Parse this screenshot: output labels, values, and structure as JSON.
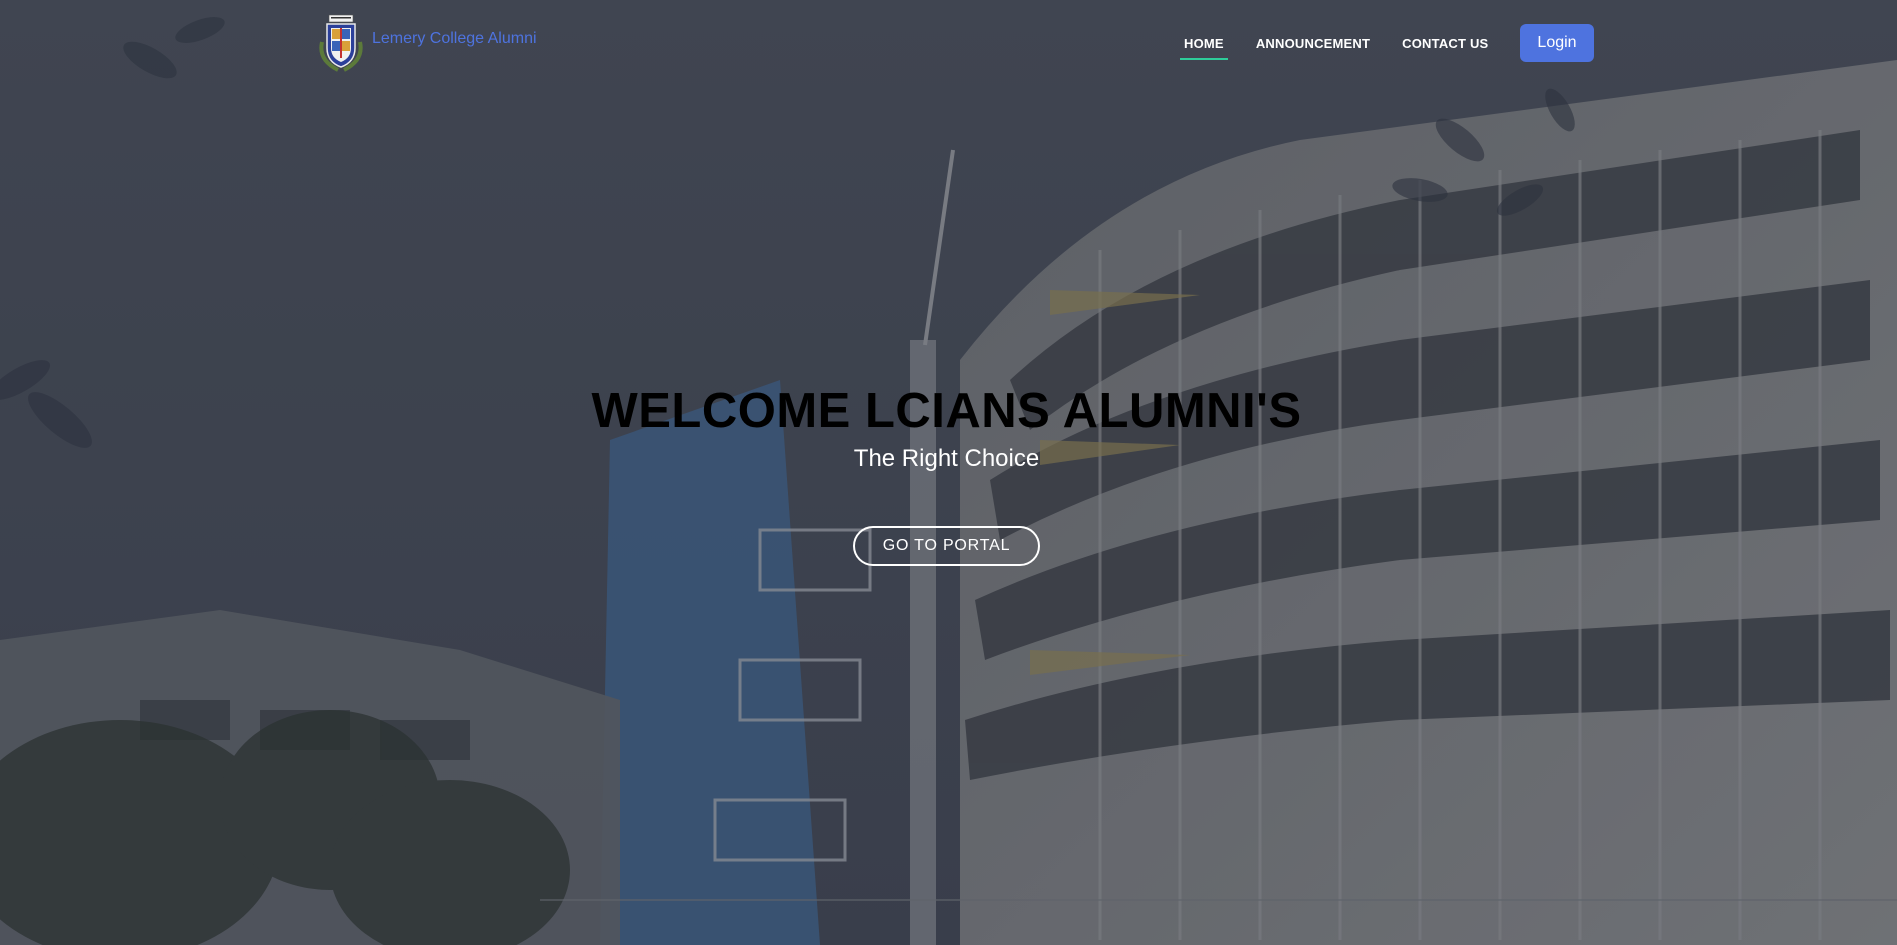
{
  "brand": {
    "name": "Lemery College Alumni",
    "logo_icon": "school-crest-icon",
    "color": "#4e73df"
  },
  "nav": {
    "items": [
      {
        "label": "HOME",
        "active": true
      },
      {
        "label": "ANNOUNCEMENT",
        "active": false
      },
      {
        "label": "CONTACT US",
        "active": false
      }
    ],
    "login_label": "Login",
    "active_underline_color": "#2ecc9a"
  },
  "hero": {
    "title": "WELCOME LCIANS ALUMNI'S",
    "subtitle": "The Right Choice",
    "cta_label": "GO TO PORTAL",
    "background": "campus-building-photo"
  },
  "colors": {
    "accent": "#4e73df",
    "overlay": "#3f4350"
  }
}
